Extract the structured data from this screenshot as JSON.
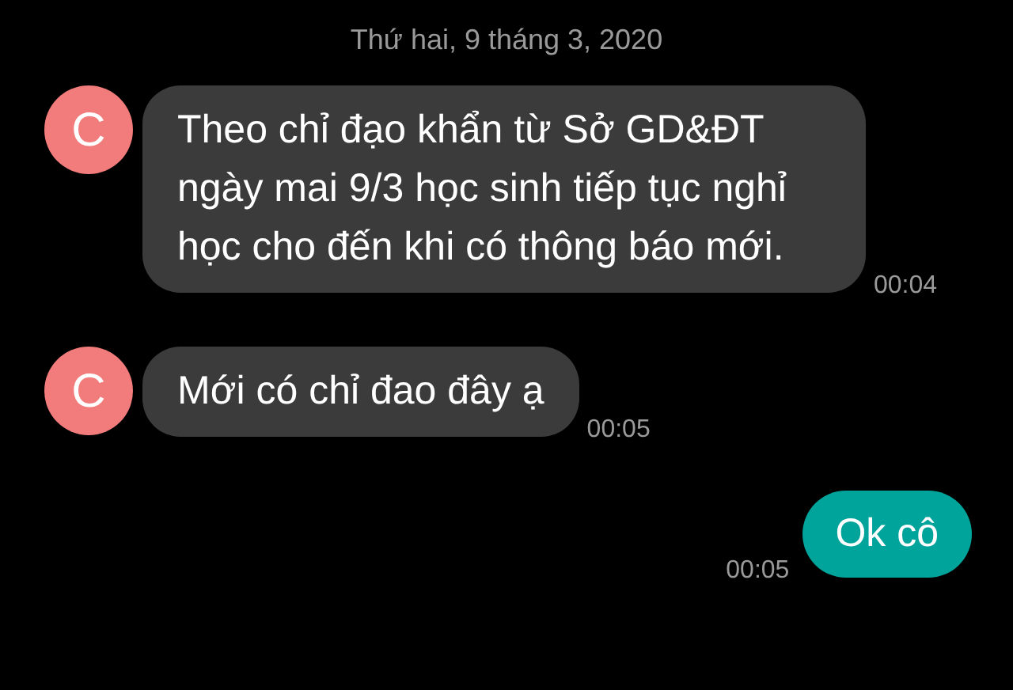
{
  "date_header": "Thứ hai, 9 tháng 3, 2020",
  "messages": [
    {
      "kind": "incoming",
      "avatar": "C",
      "text": "Theo chỉ đạo khẩn từ Sở GD&ĐT ngày mai 9/3 học sinh tiếp tục nghỉ học cho đến khi có thông báo mới.",
      "time": "00:04"
    },
    {
      "kind": "incoming",
      "avatar": "C",
      "text": "Mới có chỉ đao đây ạ",
      "time": "00:05"
    },
    {
      "kind": "outgoing",
      "text": "Ok cô",
      "time": "00:05"
    }
  ]
}
